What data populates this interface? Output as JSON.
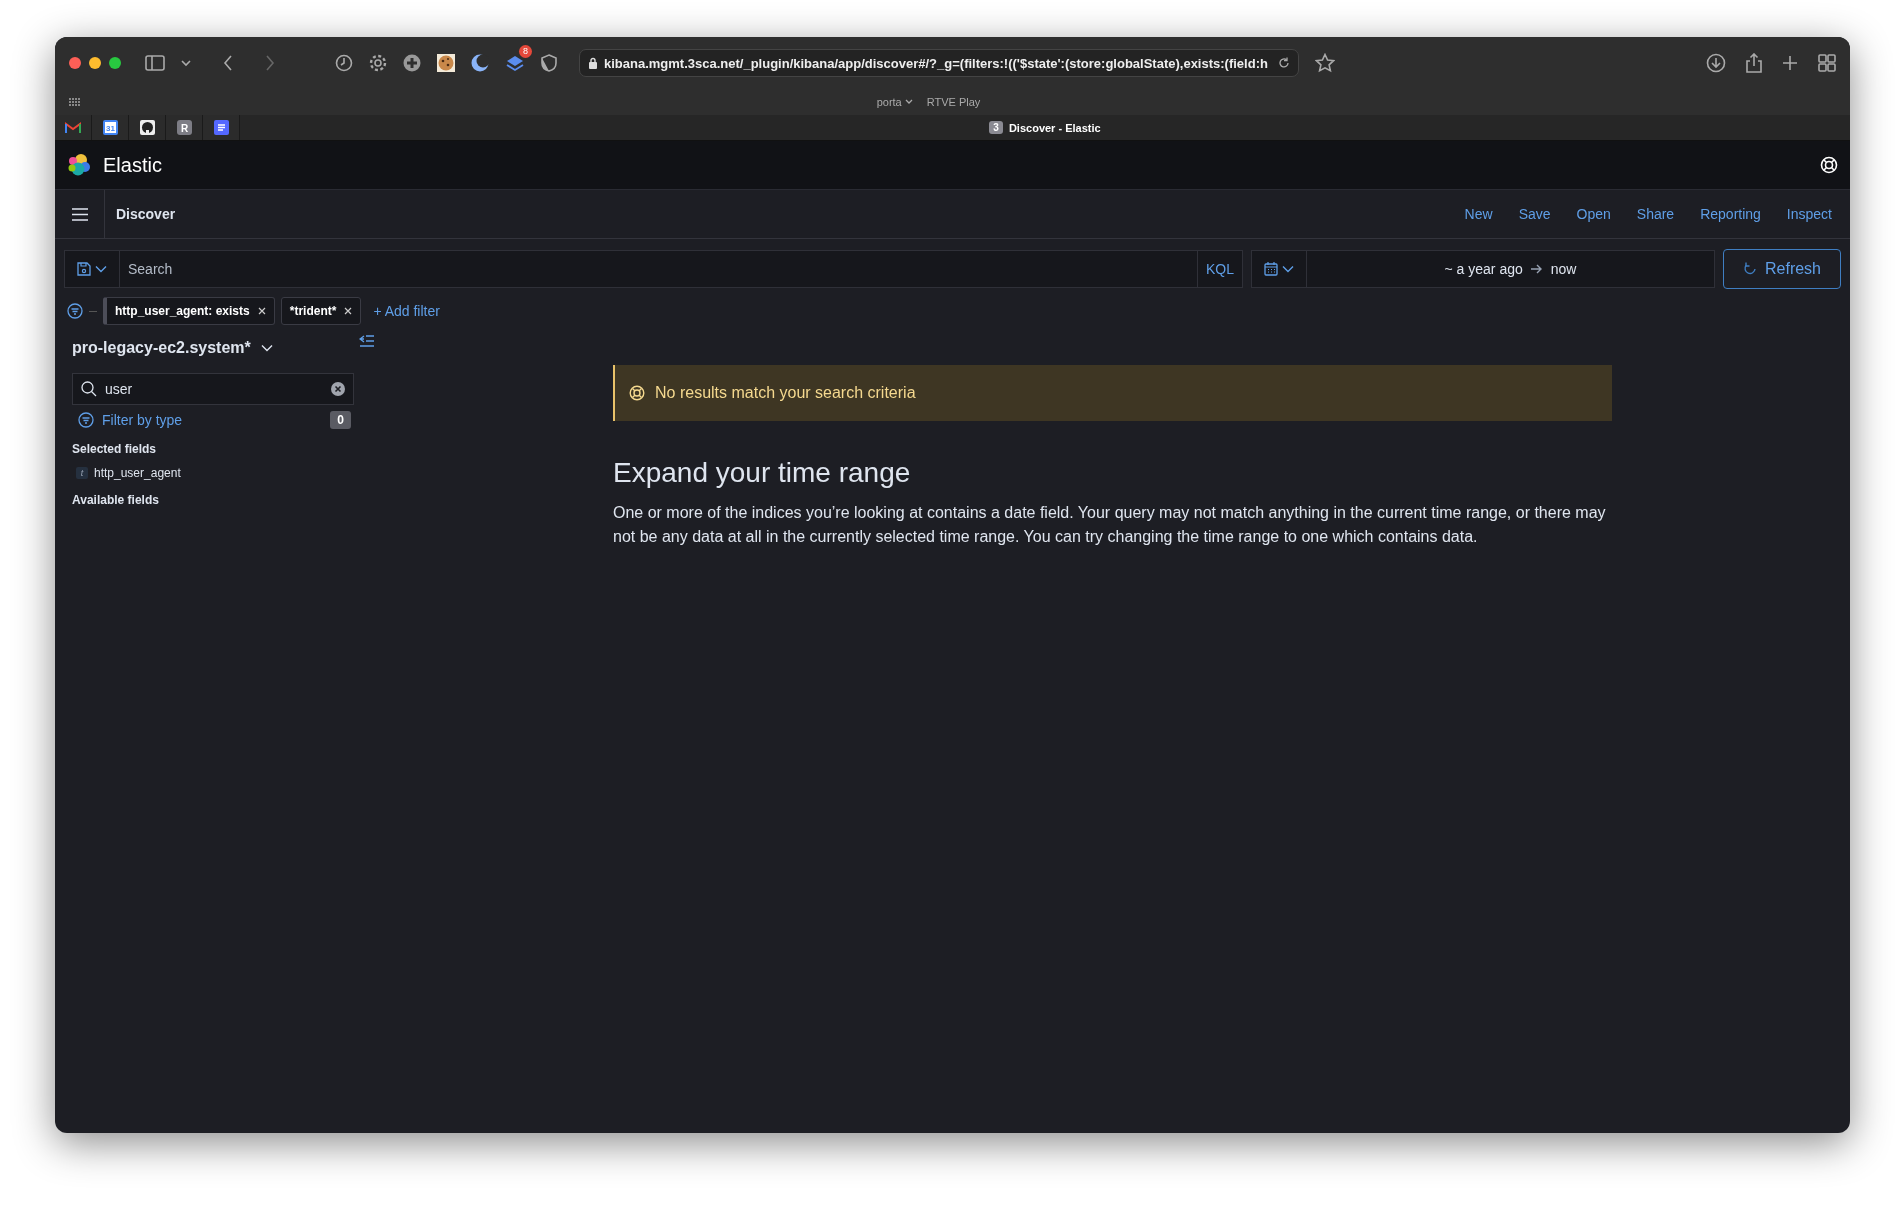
{
  "browser": {
    "extension_badge": "8",
    "url": "kibana.mgmt.3sca.net/_plugin/kibana/app/discover#/?_g=(filters:!(('$state':(store:globalState),exists:(field:h",
    "favorites": [
      {
        "label": "porta",
        "menu": true
      },
      {
        "label": "RTVE Play",
        "menu": false
      }
    ],
    "pinned_tabs": [
      {
        "kind": "mail"
      },
      {
        "kind": "calendar",
        "text": "31"
      },
      {
        "kind": "github"
      },
      {
        "kind": "letter",
        "text": "R"
      },
      {
        "kind": "docs"
      }
    ],
    "active_tab": {
      "count": "3",
      "title": "Discover - Elastic"
    }
  },
  "app": {
    "brand": "Elastic",
    "breadcrumb": "Discover",
    "top_nav": [
      "New",
      "Save",
      "Open",
      "Share",
      "Reporting",
      "Inspect"
    ],
    "query": {
      "placeholder": "Search",
      "language": "KQL",
      "time_start": "~ a year ago",
      "time_end": "now",
      "refresh": "Refresh"
    },
    "filters": [
      {
        "label": "http_user_agent: exists"
      },
      {
        "label": "*trident*"
      }
    ],
    "add_filter": "+ Add filter",
    "sidebar": {
      "index_pattern": "pro-legacy-ec2.system*",
      "field_search": "user",
      "filter_by_type": "Filter by type",
      "filter_count": "0",
      "sections": [
        {
          "title": "Selected fields",
          "fields": [
            {
              "type": "t",
              "name": "http_user_agent"
            }
          ]
        },
        {
          "title": "Available fields"
        }
      ]
    },
    "callout": {
      "title": "No results match your search criteria"
    },
    "heading": "Expand your time range",
    "paragraph": "One or more of the indices you’re looking at contains a date field. Your query may not match anything in the current time range, or there may not be any data at all in the currently selected time range. You can try changing the time range to one which contains data."
  }
}
